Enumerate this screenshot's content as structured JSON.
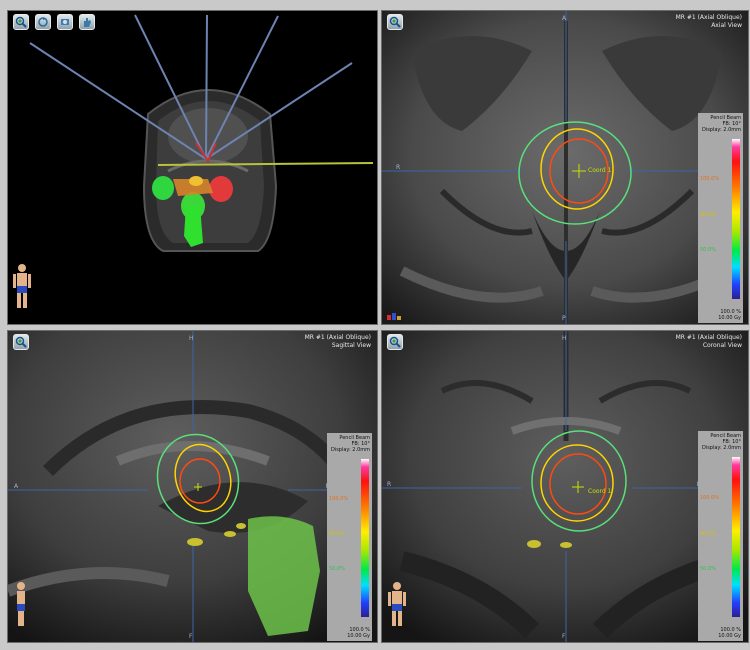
{
  "views": {
    "axial": {
      "header_line1": "MR #1 (Axial Oblique)",
      "header_line2": "Axial View",
      "ori_left": "R",
      "ori_right": "L",
      "ori_top": "A",
      "ori_bottom": "P"
    },
    "sagittal": {
      "header_line1": "MR #1 (Axial Oblique)",
      "header_line2": "Sagittal View",
      "ori_left": "A",
      "ori_right": "P",
      "ori_top": "H",
      "ori_bottom": "F"
    },
    "coronal": {
      "header_line1": "MR #1 (Axial Oblique)",
      "header_line2": "Coronal View",
      "ori_left": "R",
      "ori_right": "L",
      "ori_top": "H",
      "ori_bottom": "F"
    }
  },
  "target_label": "Coord 1",
  "dose_panel": {
    "title": "Pencil Beam",
    "fraction": "FB: 10°",
    "display": "Display: 2.0mm",
    "levels": [
      "100.0%",
      "90.0%",
      "50.0%"
    ],
    "min_label": "100.0 %",
    "max_label": "10.00 Gy"
  },
  "toolbar": {
    "icons": [
      "zoom-icon",
      "rotate-icon",
      "gantry-icon",
      "hand-icon"
    ]
  },
  "colors": {
    "isodose_high": "#ff4a10",
    "isodose_mid": "#ffd400",
    "isodose_low": "#59e07a",
    "crosshair": "#3a64a8",
    "structure": "#6cc24a"
  }
}
